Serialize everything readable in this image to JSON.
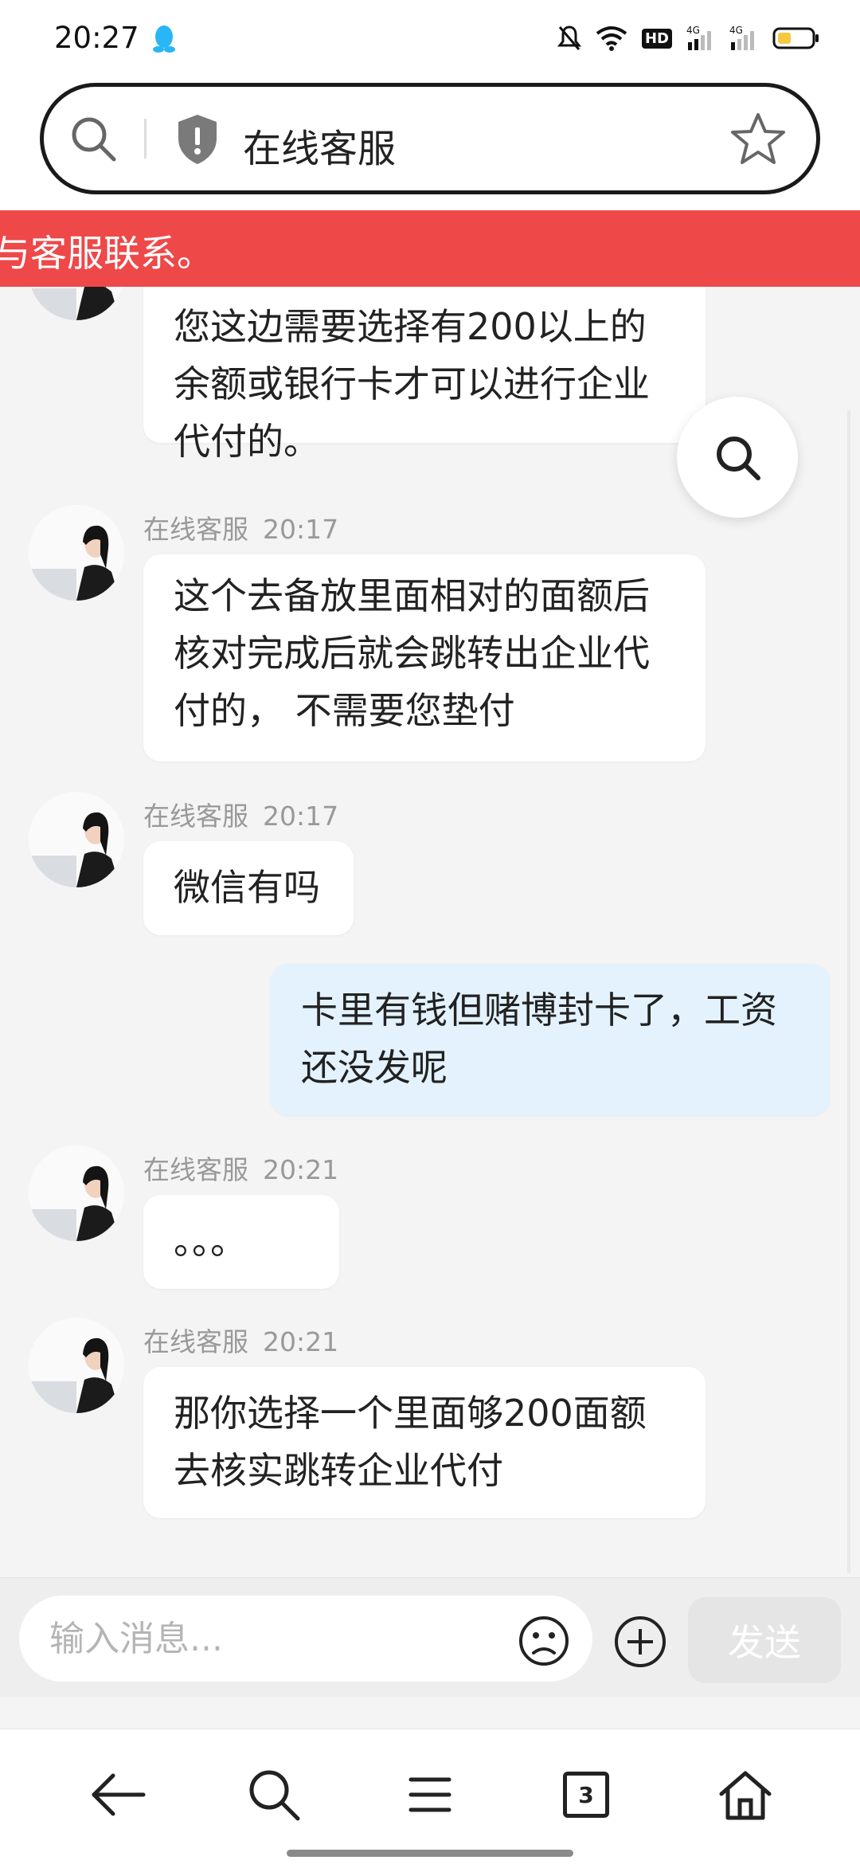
{
  "status_bar": {
    "time": "20:27",
    "hd_label": "HD",
    "network_1": "4G",
    "network_2": "4G"
  },
  "address_bar": {
    "title": "在线客服"
  },
  "notice": {
    "text": "与客服联系。"
  },
  "agent_name": "在线客服",
  "messages": [
    {
      "from": "agent",
      "lines": [
        "您这边需要选择有200以上的",
        "余额或银行卡才可以进行企业",
        "代付的。"
      ]
    },
    {
      "from": "agent",
      "name": "在线客服",
      "time": "20:17",
      "lines": [
        "这个去备放里面相对的面额后",
        "核对完成后就会跳转出企业代",
        "付的， 不需要您垫付"
      ]
    },
    {
      "from": "agent",
      "name": "在线客服",
      "time": "20:17",
      "lines": [
        "微信有吗"
      ]
    },
    {
      "from": "user",
      "lines": [
        "卡里有钱但赌博封卡了，工资",
        "还没发呢"
      ]
    },
    {
      "from": "agent",
      "name": "在线客服",
      "time": "20:21",
      "lines": [
        "。。。"
      ]
    },
    {
      "from": "agent",
      "name": "在线客服",
      "time": "20:21",
      "lines": [
        "那你选择一个里面够200面额",
        "去核实跳转企业代付"
      ]
    }
  ],
  "composer": {
    "placeholder": "输入消息...",
    "send_label": "发送"
  },
  "bottom_nav": {
    "tab_count": "3"
  },
  "colors": {
    "banner": "#ee4849",
    "user_bubble": "#e3f2fd",
    "send_disabled": "#e5e5e5"
  },
  "icons": [
    "search-icon",
    "shield-icon",
    "star-icon",
    "emoji-icon",
    "plus-icon",
    "back-arrow-icon",
    "menu-icon",
    "home-icon"
  ]
}
